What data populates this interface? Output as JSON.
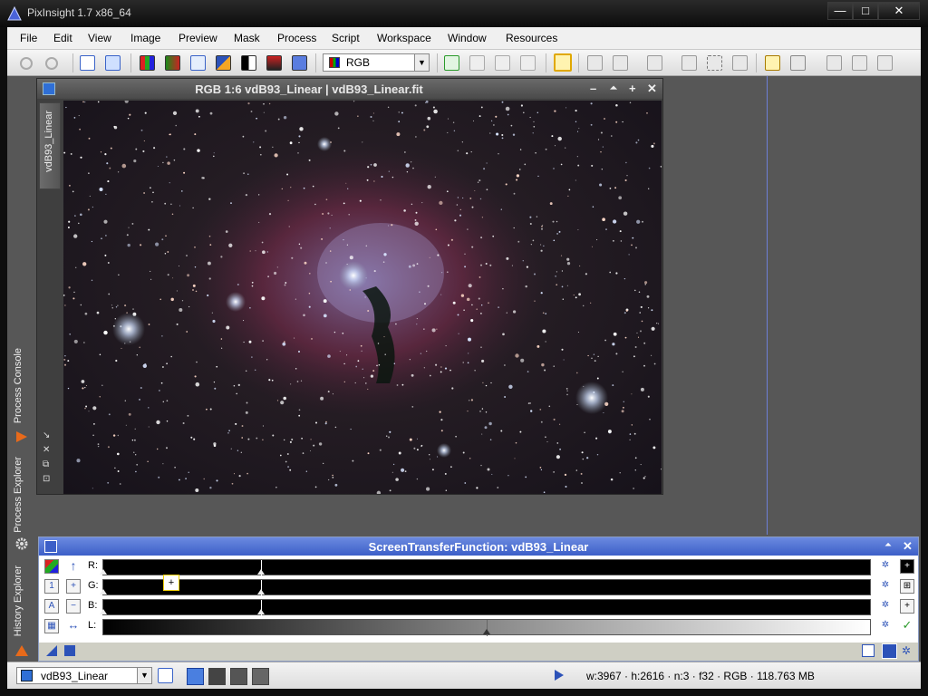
{
  "app": {
    "title": "PixInsight 1.7 x86_64"
  },
  "window_controls": {
    "minimize": "—",
    "maximize": "□",
    "close": "✕"
  },
  "menu": [
    "File",
    "Edit",
    "View",
    "Image",
    "Preview",
    "Mask",
    "Process",
    "Script",
    "Workspace",
    "Window",
    "Resources"
  ],
  "toolbar": {
    "color_space": "RGB"
  },
  "left_dock": {
    "tabs": [
      "Process Console",
      "Process Explorer",
      "History Explorer"
    ]
  },
  "image_window": {
    "title": "RGB 1:6 vdB93_Linear | vdB93_Linear.fit",
    "tab_label": "vdB93_Linear",
    "controls": {
      "minimize": "–",
      "shade": "⏶",
      "maximize": "+",
      "close": "✕"
    }
  },
  "stf_panel": {
    "title": "ScreenTransferFunction: vdB93_Linear",
    "channels": [
      "R:",
      "G:",
      "B:",
      "L:"
    ]
  },
  "statusbar": {
    "view": "vdB93_Linear",
    "info": "w:3967 · h:2616 · n:3 · f32 · RGB · 118.763 MB"
  },
  "colors": {
    "accent": "#3c5fc8",
    "workspace": "#575757",
    "guide_line": "#6d7fd6"
  }
}
